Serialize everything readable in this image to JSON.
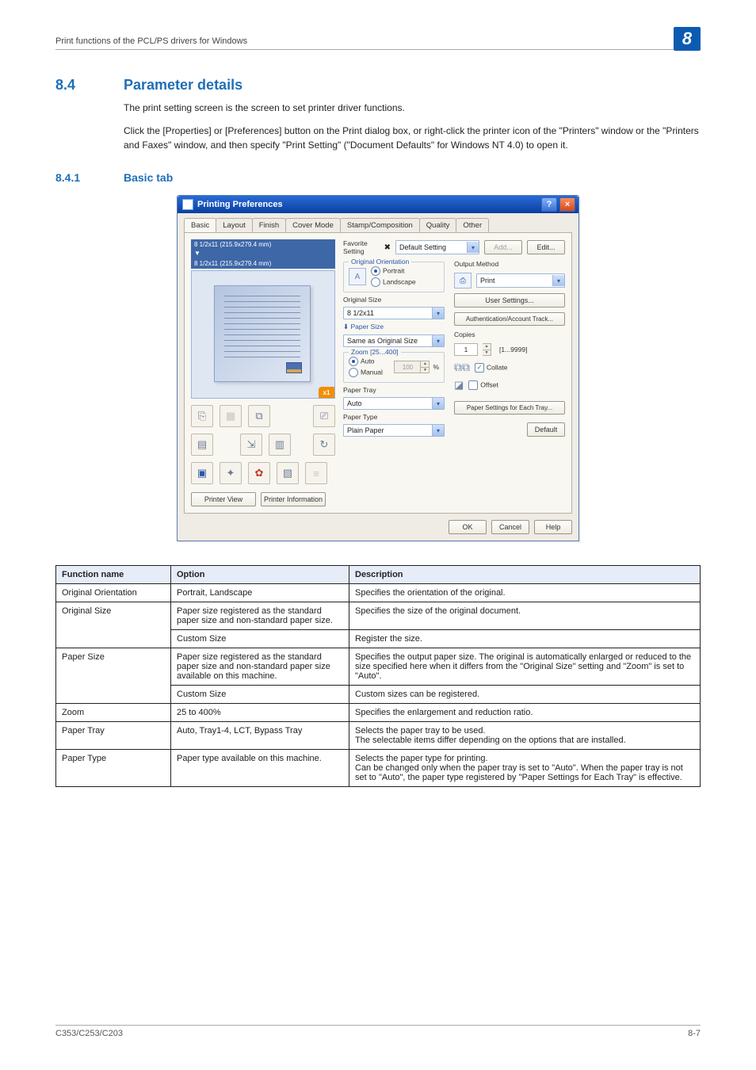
{
  "header": {
    "doc_section": "Print functions of the PCL/PS drivers for Windows",
    "chapter": "8"
  },
  "section": {
    "num": "8.4",
    "title": "Parameter details",
    "p1": "The print setting screen is the screen to set printer driver functions.",
    "p2": "Click the [Properties] or [Preferences] button on the Print dialog box, or right-click the printer icon of the \"Printers\" window or the \"Printers and Faxes\" window, and then specify \"Print Setting\" (\"Document Defaults\" for Windows NT 4.0) to open it."
  },
  "subsection": {
    "num": "8.4.1",
    "title": "Basic tab"
  },
  "dialog": {
    "title": "Printing Preferences",
    "tabs": [
      "Basic",
      "Layout",
      "Finish",
      "Cover Mode",
      "Stamp/Composition",
      "Quality",
      "Other"
    ],
    "favorite": {
      "label": "Favorite Setting",
      "value": "Default Setting",
      "add": "Add...",
      "edit": "Edit..."
    },
    "preview": {
      "line1": "8 1/2x11 (215.9x279.4 mm)",
      "line2": "8 1/2x11 (215.9x279.4 mm)",
      "badge": "x1"
    },
    "orientation": {
      "title": "Original Orientation",
      "portrait": "Portrait",
      "landscape": "Landscape"
    },
    "original_size": {
      "label": "Original Size",
      "value": "8 1/2x11"
    },
    "paper_size": {
      "label": "Paper Size",
      "value": "Same as Original Size"
    },
    "zoom": {
      "title": "Zoom [25...400]",
      "auto": "Auto",
      "manual": "Manual",
      "value": "100",
      "pct": "%"
    },
    "paper_tray": {
      "label": "Paper Tray",
      "value": "Auto"
    },
    "paper_type": {
      "label": "Paper Type",
      "value": "Plain Paper"
    },
    "output_method": {
      "label": "Output Method",
      "value": "Print"
    },
    "user_settings": "User Settings...",
    "auth_track": "Authentication/Account Track...",
    "copies": {
      "label": "Copies",
      "value": "1",
      "range": "[1...9999]",
      "collate": "Collate",
      "offset": "Offset"
    },
    "paper_settings_each_tray": "Paper Settings for Each Tray...",
    "printer_view": "Printer View",
    "printer_info": "Printer Information",
    "default": "Default",
    "ok": "OK",
    "cancel": "Cancel",
    "help": "Help"
  },
  "table": {
    "headers": {
      "fn": "Function name",
      "opt": "Option",
      "desc": "Description"
    },
    "rows": [
      {
        "fn": "Original Orientation",
        "opt": "Portrait, Landscape",
        "desc": "Specifies the orientation of the original."
      },
      {
        "fn": "Original Size",
        "opt": "Paper size registered as the standard paper size and non-standard paper size.",
        "desc": "Specifies the size of the original document.",
        "span_fn": 2
      },
      {
        "fn": "",
        "opt": "Custom Size",
        "desc": "Register the size."
      },
      {
        "fn": "Paper Size",
        "opt": "Paper size registered as the standard paper size and non-standard paper size available on this machine.",
        "desc": "Specifies the output paper size. The original is automatically enlarged or reduced to the size specified here when it differs from the \"Original Size\" setting and \"Zoom\" is set to \"Auto\".",
        "span_fn": 2
      },
      {
        "fn": "",
        "opt": "Custom Size",
        "desc": "Custom sizes can be registered."
      },
      {
        "fn": "Zoom",
        "opt": "25 to 400%",
        "desc": "Specifies the enlargement and reduction ratio."
      },
      {
        "fn": "Paper Tray",
        "opt": "Auto, Tray1-4, LCT, Bypass Tray",
        "desc": "Selects the paper tray to be used.\nThe selectable items differ depending on the options that are installed."
      },
      {
        "fn": "Paper Type",
        "opt": "Paper type available on this machine.",
        "desc": "Selects the paper type for printing.\nCan be changed only when the paper tray is set to \"Auto\". When the paper tray is not set to \"Auto\", the paper type registered by \"Paper Settings for Each Tray\" is effective."
      }
    ]
  },
  "footer": {
    "model": "C353/C253/C203",
    "page": "8-7"
  }
}
